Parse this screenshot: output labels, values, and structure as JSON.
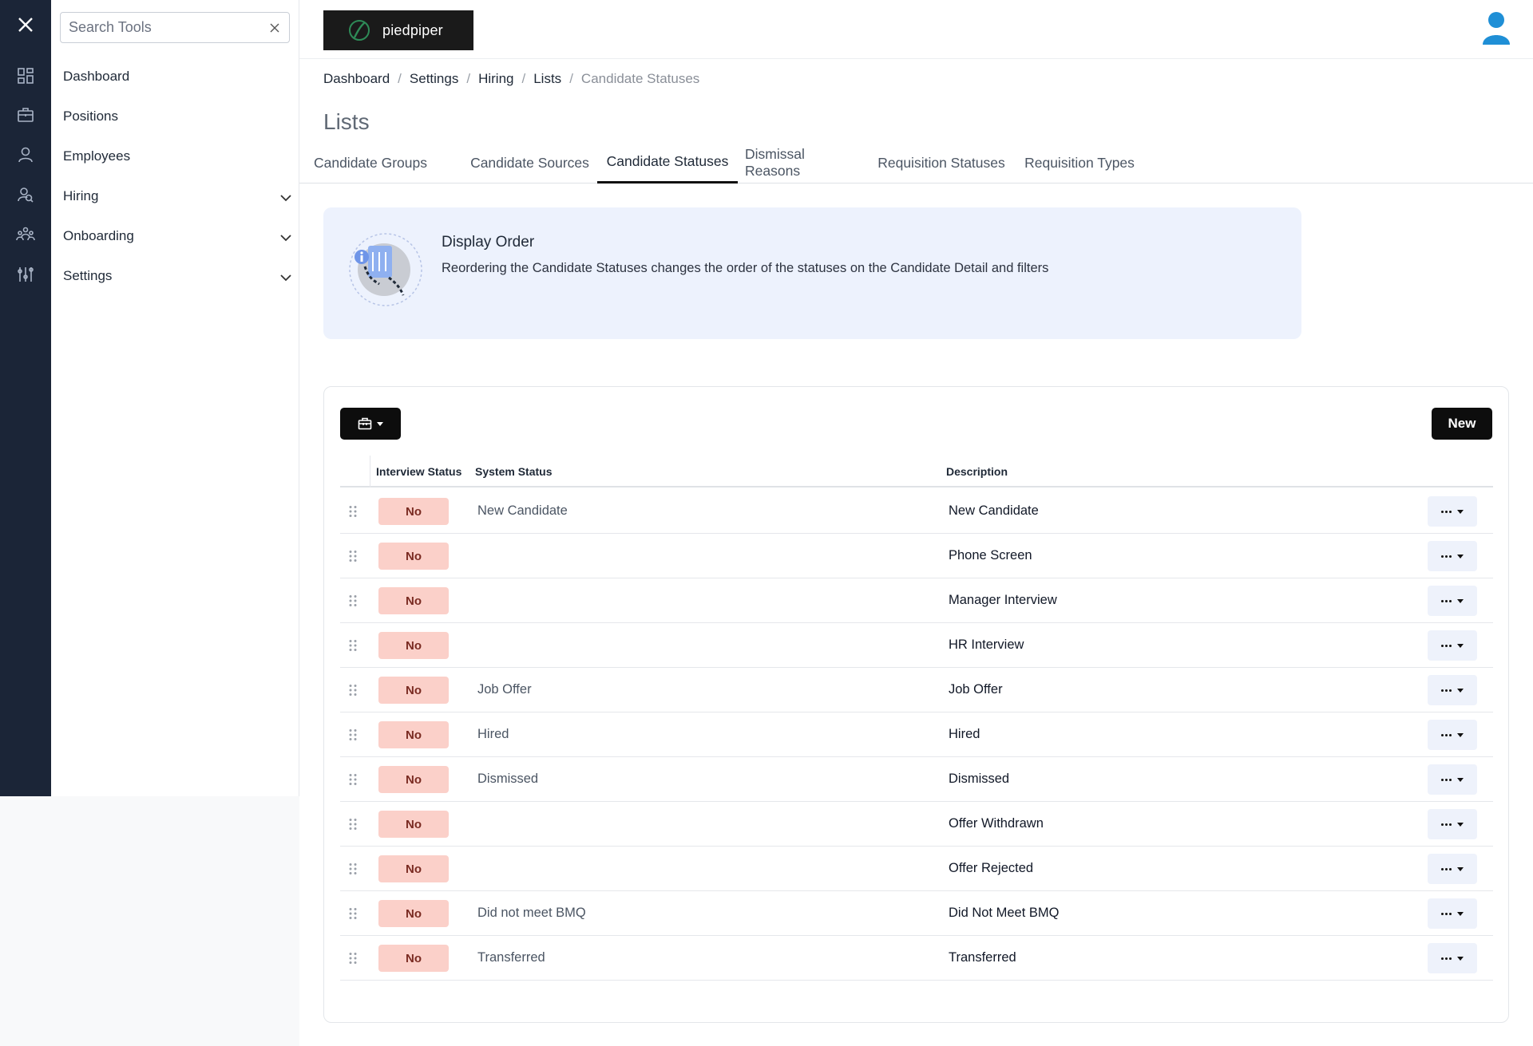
{
  "search": {
    "placeholder": "Search Tools"
  },
  "sidebar": {
    "items": [
      {
        "label": "Dashboard",
        "expandable": false
      },
      {
        "label": "Positions",
        "expandable": false
      },
      {
        "label": "Employees",
        "expandable": false
      },
      {
        "label": "Hiring",
        "expandable": true
      },
      {
        "label": "Onboarding",
        "expandable": true
      },
      {
        "label": "Settings",
        "expandable": true
      }
    ]
  },
  "rail": {
    "icons": [
      "close-icon",
      "dashboard-icon",
      "briefcase-icon",
      "person-icon",
      "hiring-icon",
      "team-icon",
      "settings-sliders-icon"
    ]
  },
  "header": {
    "logo_text": "piedpiper"
  },
  "breadcrumb": [
    "Dashboard",
    "Settings",
    "Hiring",
    "Lists",
    "Candidate Statuses"
  ],
  "page": {
    "title": "Lists"
  },
  "tabs": [
    {
      "label": "Candidate Groups",
      "active": false
    },
    {
      "label": "Candidate Sources",
      "active": false
    },
    {
      "label": "Candidate Statuses",
      "active": true
    },
    {
      "label": "Dismissal Reasons",
      "active": false
    },
    {
      "label": "Requisition Statuses",
      "active": false
    },
    {
      "label": "Requisition Types",
      "active": false
    }
  ],
  "banner": {
    "title": "Display Order",
    "text": "Reordering the Candidate Statuses changes the order of the statuses on the Candidate Detail and filters"
  },
  "toolbar": {
    "new_label": "New"
  },
  "table": {
    "columns": [
      "Interview Status",
      "System Status",
      "Description"
    ],
    "rows": [
      {
        "interview": "No",
        "system": "New Candidate",
        "description": "New Candidate"
      },
      {
        "interview": "No",
        "system": "",
        "description": "Phone Screen"
      },
      {
        "interview": "No",
        "system": "",
        "description": "Manager Interview"
      },
      {
        "interview": "No",
        "system": "",
        "description": "HR Interview"
      },
      {
        "interview": "No",
        "system": "Job Offer",
        "description": "Job Offer"
      },
      {
        "interview": "No",
        "system": "Hired",
        "description": "Hired"
      },
      {
        "interview": "No",
        "system": "Dismissed",
        "description": "Dismissed"
      },
      {
        "interview": "No",
        "system": "",
        "description": "Offer Withdrawn"
      },
      {
        "interview": "No",
        "system": "",
        "description": "Offer Rejected"
      },
      {
        "interview": "No",
        "system": "Did not meet BMQ",
        "description": "Did Not Meet BMQ"
      },
      {
        "interview": "No",
        "system": "Transferred",
        "description": "Transferred"
      }
    ]
  },
  "colors": {
    "rail_bg": "#1b2537",
    "banner_bg": "#edf2fd",
    "pill_bg": "#fbd0c9",
    "primary_button": "#0d0d0d",
    "logo_accent": "#2e8b57"
  }
}
